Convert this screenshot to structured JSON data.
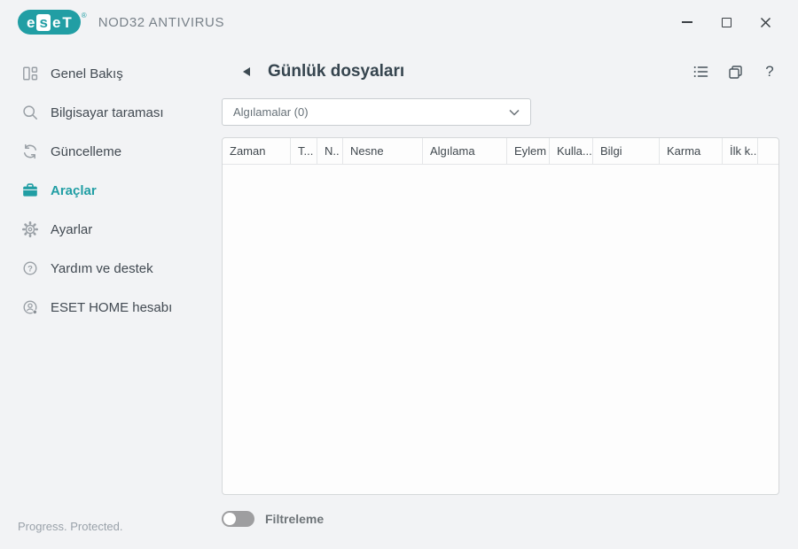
{
  "titlebar": {
    "brand": {
      "l1": "e",
      "l2": "s",
      "l3": "e",
      "l4": "T",
      "registered": "®"
    },
    "product": "NOD32 ANTIVIRUS"
  },
  "sidebar": {
    "items": [
      {
        "label": "Genel Bakış",
        "icon": "overview-icon",
        "active": false
      },
      {
        "label": "Bilgisayar taraması",
        "icon": "search-icon",
        "active": false
      },
      {
        "label": "Güncelleme",
        "icon": "sync-icon",
        "active": false
      },
      {
        "label": "Araçlar",
        "icon": "briefcase-icon",
        "active": true
      },
      {
        "label": "Ayarlar",
        "icon": "gear-icon",
        "active": false
      },
      {
        "label": "Yardım ve destek",
        "icon": "help-circle-icon",
        "active": false
      },
      {
        "label": "ESET HOME hesabı",
        "icon": "account-icon",
        "active": false
      }
    ],
    "footer": "Progress. Protected."
  },
  "main": {
    "title": "Günlük dosyaları",
    "help_glyph": "?",
    "log_type_dropdown": {
      "value": "Algılamalar (0)"
    },
    "table": {
      "columns": [
        "Zaman",
        "T...",
        "N..",
        "Nesne",
        "Algılama",
        "Eylem",
        "Kulla...",
        "Bilgi",
        "Karma",
        "İlk k..."
      ],
      "rows": []
    },
    "filter": {
      "label": "Filtreleme",
      "enabled": false
    }
  },
  "colors": {
    "brand_teal": "#219ea4",
    "background": "#f2f3f5",
    "panel": "#fdfdfd"
  }
}
